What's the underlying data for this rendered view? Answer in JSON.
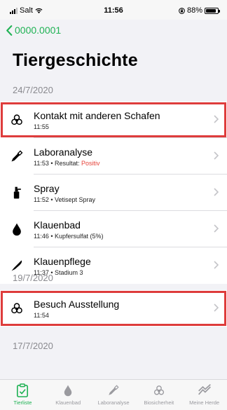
{
  "status_bar": {
    "carrier": "Salt",
    "time": "11:56",
    "battery": "88%",
    "battery_level": 0.88
  },
  "nav": {
    "back_label": "0000.0001"
  },
  "page": {
    "title": "Tiergeschichte"
  },
  "sections": [
    {
      "date": "24/7/2020",
      "items": [
        {
          "title": "Kontakt mit anderen Schafen",
          "subtitle": "11:55",
          "icon": "biohazard-icon"
        },
        {
          "title": "Laboranalyse",
          "subtitle_prefix": "11:53 • Resultat: ",
          "subtitle_highlight": "Positiv",
          "icon": "pipette-icon"
        },
        {
          "title": "Spray",
          "subtitle": "11:52 • Vetisept Spray",
          "icon": "spray-bottle-icon"
        },
        {
          "title": "Klauenbad",
          "subtitle": "11:46 • Kupfersulfat (5%)",
          "icon": "drop-icon"
        },
        {
          "title": "Klauenpflege",
          "subtitle": "11:37 • Stadium 3",
          "icon": "knife-icon"
        }
      ]
    },
    {
      "date": "19/7/2020",
      "items": [
        {
          "title": "Besuch Ausstellung",
          "subtitle": "11:54",
          "icon": "biohazard-icon"
        }
      ]
    },
    {
      "date": "17/7/2020",
      "items": []
    }
  ],
  "tabs": [
    {
      "label": "Tierliste",
      "icon": "clipboard-check-icon",
      "active": true
    },
    {
      "label": "Klauenbad",
      "icon": "drop-icon"
    },
    {
      "label": "Laboranalyse",
      "icon": "pipette-icon"
    },
    {
      "label": "Biosicherheit",
      "icon": "biohazard-icon"
    },
    {
      "label": "Meine Herde",
      "icon": "graph-icon"
    }
  ],
  "colors": {
    "accent": "#1fb254",
    "highlight_border": "#de3c3c",
    "positive_result": "#e5433a"
  }
}
